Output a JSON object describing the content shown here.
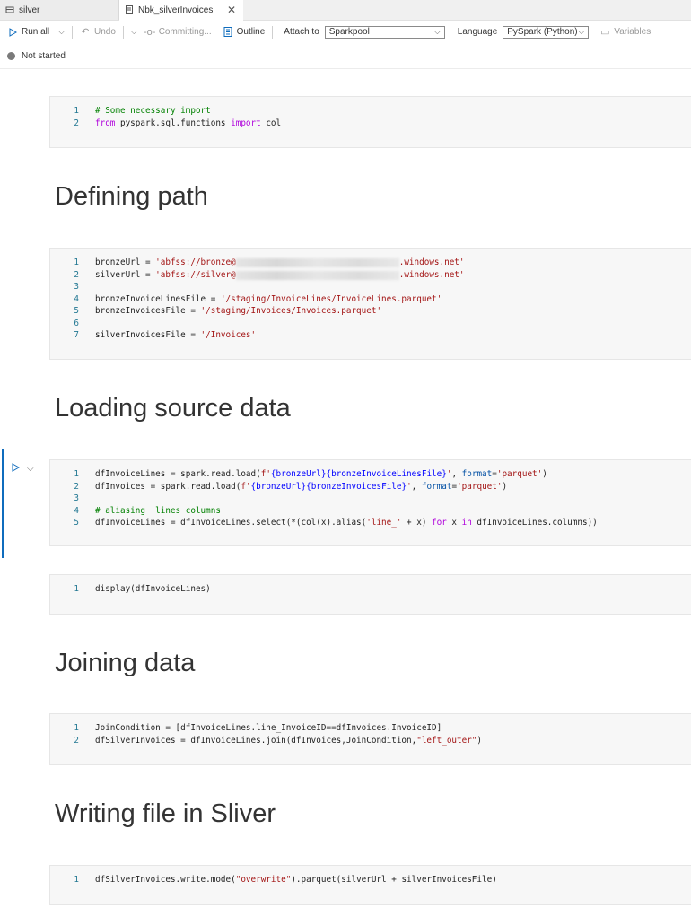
{
  "tabs": [
    {
      "label": "silver",
      "active": false
    },
    {
      "label": "Nbk_silverInvoices",
      "active": true
    }
  ],
  "toolbar": {
    "run_all": "Run all",
    "undo": "Undo",
    "committing": "Committing...",
    "outline": "Outline",
    "attach_label": "Attach to",
    "attach_value": "Sparkpool",
    "language_label": "Language",
    "language_value": "PySpark (Python)",
    "variables": "Variables"
  },
  "status": {
    "text": "Not started"
  },
  "headings": {
    "h1": "Defining path",
    "h2": "Loading source data",
    "h3": "Joining data",
    "h4": "Writing file in Sliver"
  },
  "cells": {
    "c1": {
      "lines": [
        "1",
        "2"
      ],
      "l1": "# Some necessary import",
      "l2_kw1": "from",
      "l2_mod": " pyspark.sql.functions ",
      "l2_kw2": "import",
      "l2_rest": " col"
    },
    "c2": {
      "lines": [
        "1",
        "2",
        "3",
        "4",
        "5",
        "6",
        "7"
      ],
      "l1_a": "bronzeUrl = ",
      "l1_s1": "'abfss://bronze@",
      "l1_s2": ".windows.net'",
      "l2_a": "silverUrl = ",
      "l2_s1": "'abfss://silver@",
      "l2_s2": ".windows.net'",
      "l4_a": "bronzeInvoiceLinesFile = ",
      "l4_s": "'/staging/InvoiceLines/InvoiceLines.parquet'",
      "l5_a": "bronzeInvoicesFile = ",
      "l5_s": "'/staging/Invoices/Invoices.parquet'",
      "l7_a": "silverInvoicesFile = ",
      "l7_s": "'/Invoices'"
    },
    "c3": {
      "lines": [
        "1",
        "2",
        "3",
        "4",
        "5"
      ],
      "l1_a": "dfInvoiceLines = spark.read.load(",
      "l1_f": "f'",
      "l1_b1": "{bronzeUrl}",
      "l1_b2": "{bronzeInvoiceLinesFile}",
      "l1_q": "'",
      "l1_c": ", ",
      "l1_kw": "format",
      "l1_eq": "=",
      "l1_s": "'parquet'",
      "l1_e": ")",
      "l2_a": "dfInvoices = spark.read.load(",
      "l2_f": "f'",
      "l2_b1": "{bronzeUrl}",
      "l2_b2": "{bronzeInvoicesFile}",
      "l2_q": "'",
      "l2_c": ", ",
      "l2_kw": "format",
      "l2_eq": "=",
      "l2_s": "'parquet'",
      "l2_e": ")",
      "l4": "# aliasing  lines columns",
      "l5_a": "dfInvoiceLines = dfInvoiceLines.select(*(col(x).alias(",
      "l5_s": "'line_'",
      "l5_b": " + x) ",
      "l5_for": "for",
      "l5_c": " x ",
      "l5_in": "in",
      "l5_d": " dfInvoiceLines.columns))"
    },
    "c4": {
      "lines": [
        "1"
      ],
      "l1": "display(dfInvoiceLines)"
    },
    "c5": {
      "lines": [
        "1",
        "2"
      ],
      "l1": "JoinCondition = [dfInvoiceLines.line_InvoiceID==dfInvoices.InvoiceID]",
      "l2_a": "dfSilverInvoices = dfInvoiceLines.join(dfInvoices,JoinCondition,",
      "l2_s": "\"left_outer\"",
      "l2_e": ")"
    },
    "c6": {
      "lines": [
        "1"
      ],
      "l1_a": "dfSilverInvoices.write.mode(",
      "l1_s": "\"overwrite\"",
      "l1_e": ").parquet(silverUrl + silverInvoicesFile)"
    }
  }
}
